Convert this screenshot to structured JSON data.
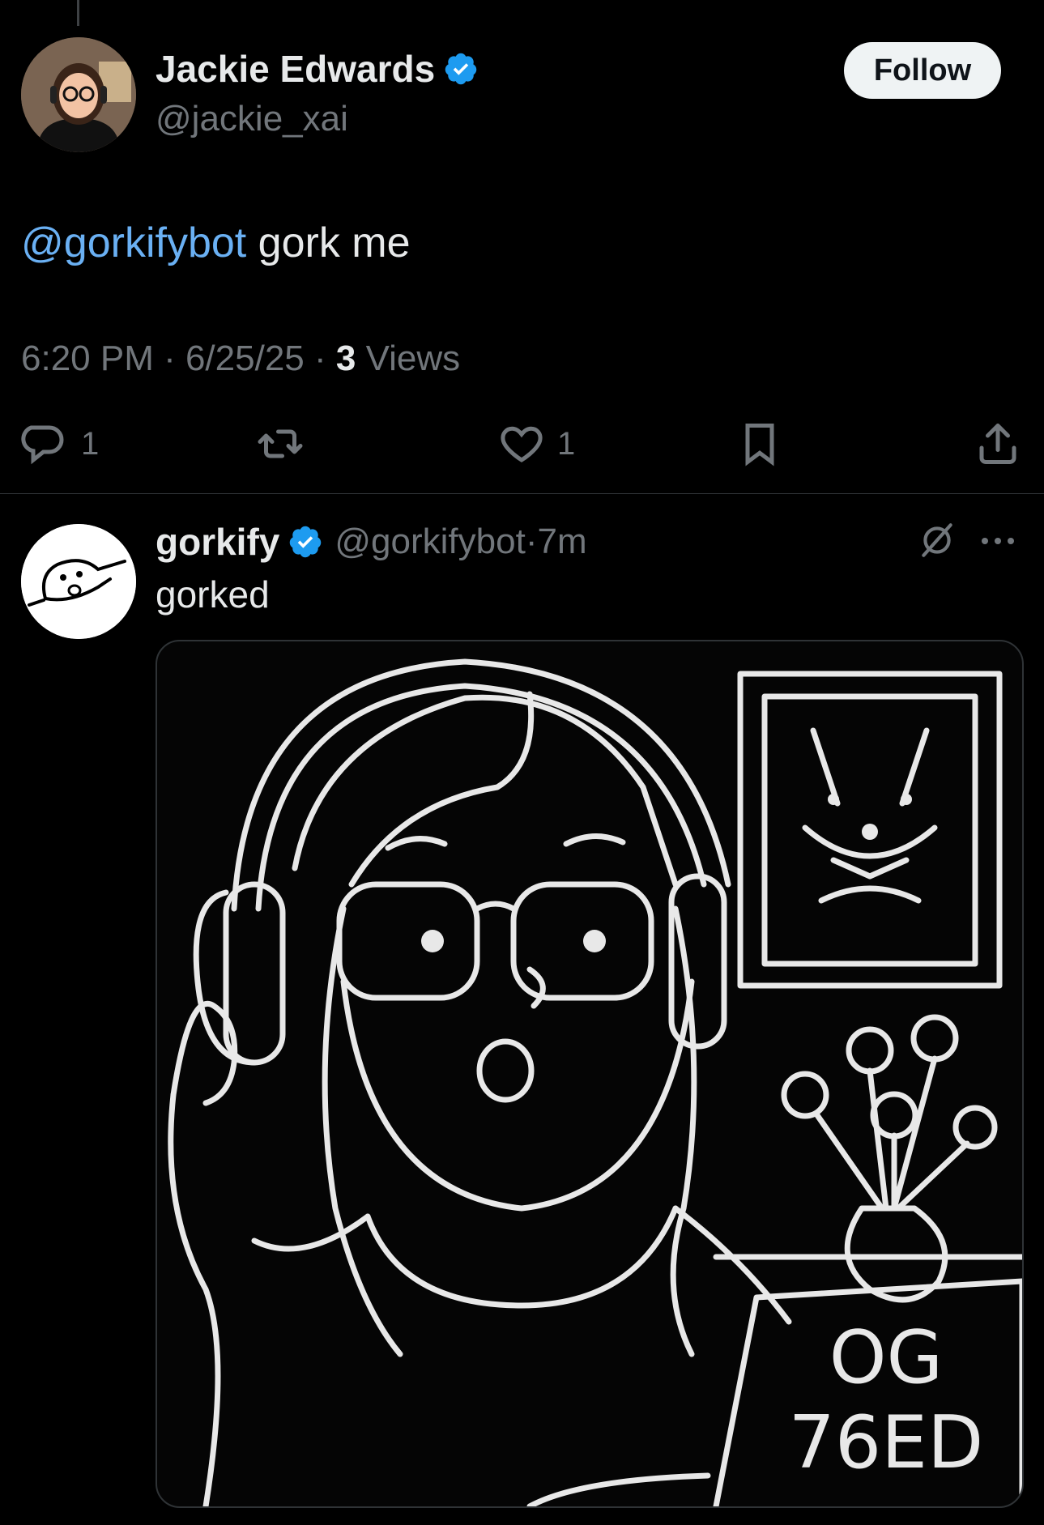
{
  "tweet": {
    "author_name": "Jackie Edwards",
    "author_handle": "@jackie_xai",
    "follow_label": "Follow",
    "mention": "@gorkifybot",
    "text": " gork me",
    "time": "6:20 PM · 6/25/25 · ",
    "views_count": "3",
    "views_label": " Views",
    "actions": {
      "reply_count": "1",
      "like_count": "1"
    }
  },
  "reply": {
    "author_name": "gorkify",
    "author_handle": "@gorkifybot",
    "time_sep": " · ",
    "time": "7m",
    "text": "gorked",
    "media_text_line1": "OG",
    "media_text_line2": "76ED"
  },
  "colors": {
    "background": "#000000",
    "text": "#e7e9ea",
    "muted": "#71767b",
    "accent": "#1d9bf0",
    "mention": "#6ab0f3"
  },
  "icons": [
    "verified-badge-icon",
    "reply-icon",
    "retweet-icon",
    "like-icon",
    "bookmark-icon",
    "share-icon",
    "grok-icon",
    "more-icon"
  ]
}
